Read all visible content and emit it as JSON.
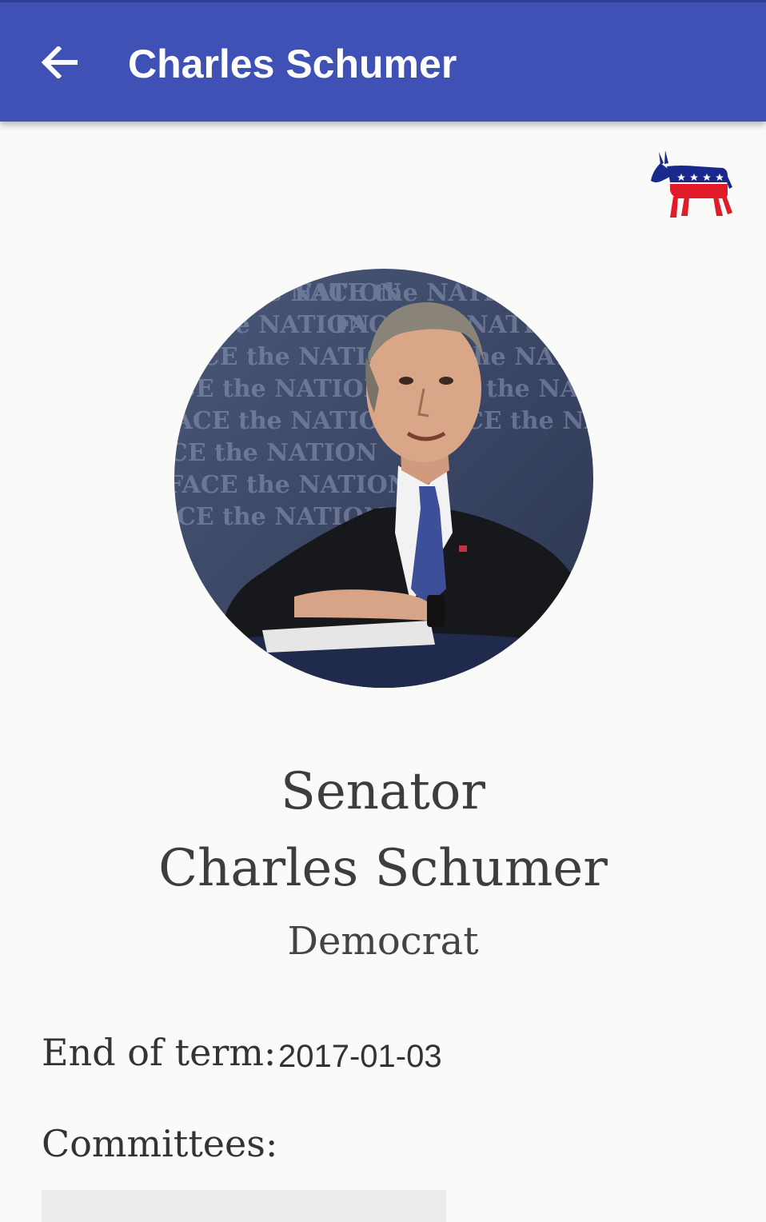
{
  "app_bar": {
    "title": "Charles Schumer",
    "back_icon": "arrow-back-icon",
    "background_color": "#3f51b5"
  },
  "party_logo": {
    "icon": "democratic-donkey-logo",
    "colors": [
      "#1a2a8c",
      "#e01b2a",
      "#ffffff"
    ]
  },
  "portrait": {
    "icon": "senator-portrait-photo",
    "backdrop_text": "FACE the NATION"
  },
  "profile": {
    "rank": "Senator",
    "name": "Charles Schumer",
    "party": "Democrat"
  },
  "details": {
    "term_label": "End of term:",
    "term_value": "2017-01-03",
    "committees_label": "Committees:"
  }
}
